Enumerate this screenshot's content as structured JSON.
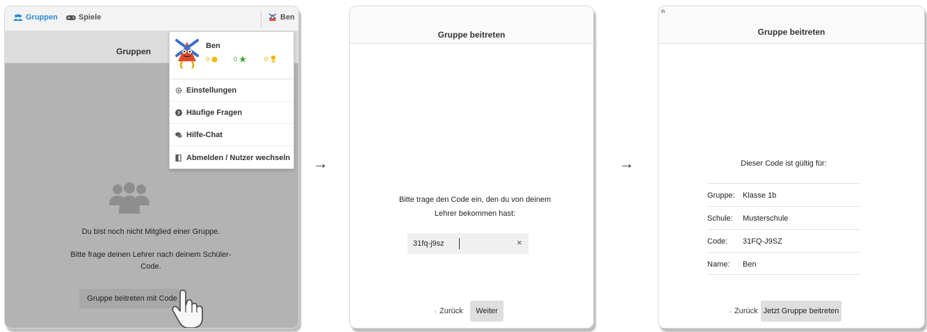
{
  "panel1": {
    "nav": {
      "gruppen_label": "Gruppen",
      "spiele_label": "Spiele",
      "user_label": "Ben"
    },
    "page_title": "Gruppen",
    "menu": {
      "username": "Ben",
      "coins": "0",
      "stars": "0",
      "trophies": "0",
      "items": [
        {
          "label": "Einstellungen",
          "icon": "gear-icon"
        },
        {
          "label": "Häufige Fragen",
          "icon": "help-icon"
        },
        {
          "label": "Hilfe-Chat",
          "icon": "chat-icon"
        },
        {
          "label": "Abmelden / Nutzer wechseln",
          "icon": "logout-icon"
        }
      ]
    },
    "message_no_group": "Du bist noch nicht Mitglied einer Gruppe.",
    "message_ask_teacher": "Bitte frage deinen Lehrer nach deinem Schüler-Code.",
    "join_button_label": "Gruppe beitreten mit Code"
  },
  "arrow_symbol": "→",
  "panel2": {
    "title": "Gruppe beitreten",
    "instructions": "Bitte trage den Code ein, den du von deinem Lehrer bekommen hast:",
    "code_value": "31fq-j9sz",
    "clear_symbol": "×",
    "back_label": "Zurück",
    "next_label": "Weiter"
  },
  "panel3": {
    "corner_text": "n",
    "title": "Gruppe beitreten",
    "valid_for": "Dieser Code ist gültig für:",
    "rows": [
      {
        "key": "Gruppe:",
        "value": "Klasse 1b"
      },
      {
        "key": "Schule:",
        "value": "Musterschule"
      },
      {
        "key": "Code:",
        "value": "31FQ-J9SZ"
      },
      {
        "key": "Name:",
        "value": "Ben"
      }
    ],
    "back_label": "Zurück",
    "join_label": "Jetzt Gruppe beitreten"
  },
  "colors": {
    "accent_blue": "#2a8ad4",
    "coin": "#e6a800",
    "star": "#3ea43b"
  }
}
